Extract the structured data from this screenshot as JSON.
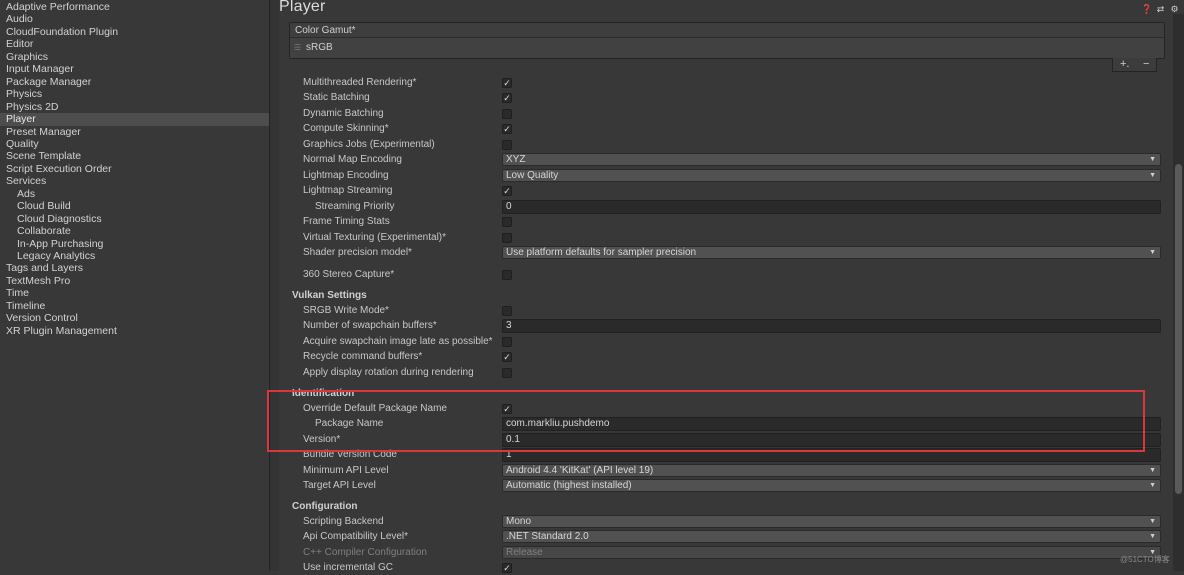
{
  "sidebar": {
    "items": [
      {
        "label": "Adaptive Performance",
        "sub": false,
        "selected": false
      },
      {
        "label": "Audio",
        "sub": false,
        "selected": false
      },
      {
        "label": "CloudFoundation Plugin",
        "sub": false,
        "selected": false
      },
      {
        "label": "Editor",
        "sub": false,
        "selected": false
      },
      {
        "label": "Graphics",
        "sub": false,
        "selected": false
      },
      {
        "label": "Input Manager",
        "sub": false,
        "selected": false
      },
      {
        "label": "Package Manager",
        "sub": false,
        "selected": false
      },
      {
        "label": "Physics",
        "sub": false,
        "selected": false
      },
      {
        "label": "Physics 2D",
        "sub": false,
        "selected": false
      },
      {
        "label": "Player",
        "sub": false,
        "selected": true
      },
      {
        "label": "Preset Manager",
        "sub": false,
        "selected": false
      },
      {
        "label": "Quality",
        "sub": false,
        "selected": false
      },
      {
        "label": "Scene Template",
        "sub": false,
        "selected": false
      },
      {
        "label": "Script Execution Order",
        "sub": false,
        "selected": false
      },
      {
        "label": "Services",
        "sub": false,
        "selected": false
      },
      {
        "label": "Ads",
        "sub": true,
        "selected": false
      },
      {
        "label": "Cloud Build",
        "sub": true,
        "selected": false
      },
      {
        "label": "Cloud Diagnostics",
        "sub": true,
        "selected": false
      },
      {
        "label": "Collaborate",
        "sub": true,
        "selected": false
      },
      {
        "label": "In-App Purchasing",
        "sub": true,
        "selected": false
      },
      {
        "label": "Legacy Analytics",
        "sub": true,
        "selected": false
      },
      {
        "label": "Tags and Layers",
        "sub": false,
        "selected": false
      },
      {
        "label": "TextMesh Pro",
        "sub": false,
        "selected": false
      },
      {
        "label": "Time",
        "sub": false,
        "selected": false
      },
      {
        "label": "Timeline",
        "sub": false,
        "selected": false
      },
      {
        "label": "Version Control",
        "sub": false,
        "selected": false
      },
      {
        "label": "XR Plugin Management",
        "sub": false,
        "selected": false
      }
    ]
  },
  "header": {
    "title": "Player",
    "icons": [
      "help-icon",
      "presets-icon",
      "gear-icon"
    ]
  },
  "color_gamut": {
    "header": "Color Gamut*",
    "items": [
      "sRGB"
    ],
    "add_symbol": "+.",
    "remove_symbol": "−"
  },
  "settings": {
    "multithreaded_rendering": {
      "label": "Multithreaded Rendering*",
      "checked": true
    },
    "static_batching": {
      "label": "Static Batching",
      "checked": true
    },
    "dynamic_batching": {
      "label": "Dynamic Batching",
      "checked": false
    },
    "compute_skinning": {
      "label": "Compute Skinning*",
      "checked": true
    },
    "graphics_jobs": {
      "label": "Graphics Jobs (Experimental)",
      "checked": false
    },
    "normal_map_encoding": {
      "label": "Normal Map Encoding",
      "value": "XYZ"
    },
    "lightmap_encoding": {
      "label": "Lightmap Encoding",
      "value": "Low Quality"
    },
    "lightmap_streaming": {
      "label": "Lightmap Streaming",
      "checked": true
    },
    "streaming_priority": {
      "label": "Streaming Priority",
      "value": "0"
    },
    "frame_timing_stats": {
      "label": "Frame Timing Stats",
      "checked": false
    },
    "virtual_texturing": {
      "label": "Virtual Texturing (Experimental)*",
      "checked": false
    },
    "shader_precision_model": {
      "label": "Shader precision model*",
      "value": "Use platform defaults for sampler precision"
    },
    "stereo_capture": {
      "label": "360 Stereo Capture*",
      "checked": false
    }
  },
  "vulkan": {
    "header": "Vulkan Settings",
    "srgb_write_mode": {
      "label": "SRGB Write Mode*",
      "checked": false
    },
    "swapchain_buffers": {
      "label": "Number of swapchain buffers*",
      "value": "3"
    },
    "acquire_swapchain_late": {
      "label": "Acquire swapchain image late as possible*",
      "checked": false
    },
    "recycle_command_buffers": {
      "label": "Recycle command buffers*",
      "checked": true
    },
    "apply_display_rotation": {
      "label": "Apply display rotation during rendering",
      "checked": false
    }
  },
  "identification": {
    "header": "Identification",
    "override_package_name": {
      "label": "Override Default Package Name",
      "checked": true
    },
    "package_name": {
      "label": "Package Name",
      "value": "com.markliu.pushdemo"
    },
    "version": {
      "label": "Version*",
      "value": "0.1"
    },
    "bundle_version_code": {
      "label": "Bundle Version Code",
      "value": "1"
    },
    "min_api_level": {
      "label": "Minimum API Level",
      "value": "Android 4.4 'KitKat' (API level 19)"
    },
    "target_api_level": {
      "label": "Target API Level",
      "value": "Automatic (highest installed)"
    }
  },
  "configuration": {
    "header": "Configuration",
    "scripting_backend": {
      "label": "Scripting Backend",
      "value": "Mono"
    },
    "api_compatibility": {
      "label": "Api Compatibility Level*",
      "value": ".NET Standard 2.0"
    },
    "cpp_compiler_config": {
      "label": "C++ Compiler Configuration",
      "value": "Release"
    },
    "incremental_gc": {
      "label": "Use incremental GC",
      "checked": true
    }
  },
  "watermark": "@51CTO博客",
  "colors": {
    "background": "#383838",
    "sidebar_selected": "#4d4d4d",
    "highlight_box": "#d9363e",
    "field_dark": "#2a2a2a",
    "dropdown": "#515151"
  }
}
